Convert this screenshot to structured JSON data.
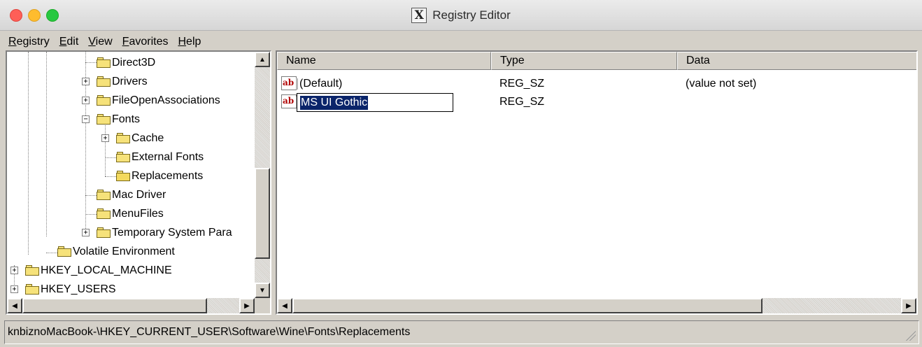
{
  "window": {
    "title": "Registry Editor",
    "title_icon": "X",
    "title_icon_name": "x11-logo-icon"
  },
  "menu": [
    {
      "label_acc": "R",
      "label_rest": "egistry"
    },
    {
      "label_acc": "E",
      "label_rest": "dit"
    },
    {
      "label_acc": "V",
      "label_rest": "iew"
    },
    {
      "label_acc": "F",
      "label_rest": "avorites"
    },
    {
      "label_acc": "H",
      "label_rest": "elp"
    }
  ],
  "tree": {
    "items": [
      {
        "label": "Direct3D",
        "expander": ""
      },
      {
        "label": "Drivers",
        "expander": "+"
      },
      {
        "label": "FileOpenAssociations",
        "expander": "+"
      },
      {
        "label": "Fonts",
        "expander": "−"
      },
      {
        "label": "Cache",
        "expander": "+"
      },
      {
        "label": "External Fonts",
        "expander": ""
      },
      {
        "label": "Replacements",
        "expander": "",
        "open": true
      },
      {
        "label": "Mac Driver",
        "expander": ""
      },
      {
        "label": "MenuFiles",
        "expander": ""
      },
      {
        "label": "Temporary System Para",
        "expander": "+"
      },
      {
        "label": "Volatile Environment",
        "expander": ""
      },
      {
        "label": "HKEY_LOCAL_MACHINE",
        "expander": "+"
      },
      {
        "label": "HKEY_USERS",
        "expander": "+"
      }
    ]
  },
  "list": {
    "columns": [
      "Name",
      "Type",
      "Data"
    ],
    "rows": [
      {
        "name": "(Default)",
        "type": "REG_SZ",
        "data": "(value not set)",
        "icon": "string-value-icon"
      },
      {
        "name": "MS UI Gothic",
        "type": "REG_SZ",
        "data": "",
        "icon": "string-value-icon",
        "editing": true
      }
    ]
  },
  "status": {
    "path": "knbiznoMacBook-\\HKEY_CURRENT_USER\\Software\\Wine\\Fonts\\Replacements"
  }
}
